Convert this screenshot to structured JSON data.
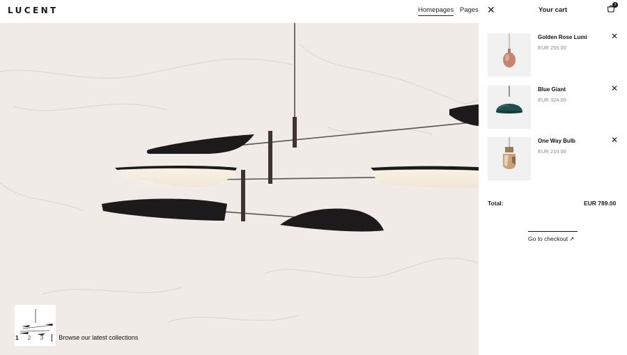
{
  "header": {
    "logo": "LUCENT",
    "nav": [
      {
        "label": "Homepages",
        "active": true
      },
      {
        "label": "Pages",
        "active": false
      }
    ]
  },
  "hero": {
    "background_color": "#f0ebe7",
    "pager": {
      "pages": [
        "1",
        "2",
        "3"
      ],
      "active_page": "1",
      "browse_label": "Browse our latest collections"
    }
  },
  "cart": {
    "title": "Your cart",
    "item_count": "3",
    "items": [
      {
        "name": "Golden Rose Lumi",
        "price": "EUR 255.00",
        "icon": "copper-pendant-lamp"
      },
      {
        "name": "Blue Giant",
        "price": "EUR 324.00",
        "icon": "teal-dome-pendant-lamp"
      },
      {
        "name": "One Way Bulb",
        "price": "EUR 210.00",
        "icon": "copper-bulb-lamp"
      }
    ],
    "total_label": "Total:",
    "total_value": "EUR 789.00",
    "checkout_label": "Go to checkout",
    "checkout_arrow": "↗"
  }
}
